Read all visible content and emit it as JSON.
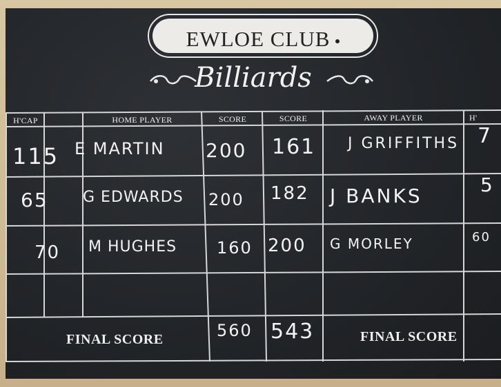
{
  "club_name": "EWLOE CLUB",
  "section": "Billiards",
  "headers": {
    "hcap": "H'CAP",
    "home_player": "HOME PLAYER",
    "home_score": "SCORE",
    "away_score": "SCORE",
    "away_player": "AWAY PLAYER",
    "away_hcap": "H'"
  },
  "rows": [
    {
      "hcap": "115",
      "home_player": "E MARTIN",
      "home_score": "200",
      "away_score": "161",
      "away_player": "J GRIFFITHS",
      "away_hcap": "7"
    },
    {
      "hcap": "65",
      "home_player": "G EDWARDS",
      "home_score": "200",
      "away_score": "182",
      "away_player": "J BANKS",
      "away_hcap": "5"
    },
    {
      "hcap": "70",
      "home_player": "M HUGHES",
      "home_score": "160",
      "away_score": "200",
      "away_player": "G MORLEY",
      "away_hcap": "60"
    }
  ],
  "final_label_home": "FINAL SCORE",
  "final_label_away": "FINAL SCORE",
  "final_home": "560",
  "final_away": "543"
}
